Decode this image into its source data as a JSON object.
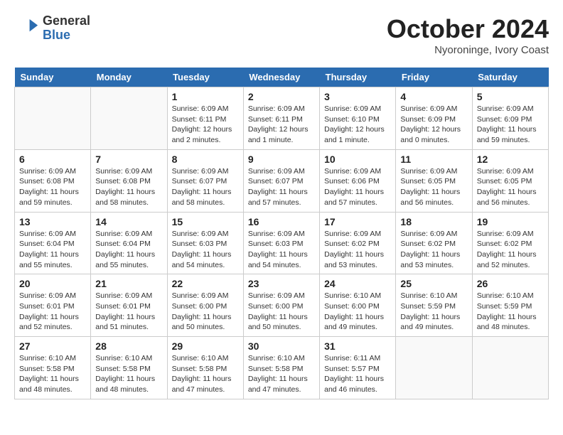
{
  "header": {
    "logo_line1": "General",
    "logo_line2": "Blue",
    "month": "October 2024",
    "location": "Nyoroninge, Ivory Coast"
  },
  "weekdays": [
    "Sunday",
    "Monday",
    "Tuesday",
    "Wednesday",
    "Thursday",
    "Friday",
    "Saturday"
  ],
  "weeks": [
    [
      {
        "day": "",
        "info": ""
      },
      {
        "day": "",
        "info": ""
      },
      {
        "day": "1",
        "info": "Sunrise: 6:09 AM\nSunset: 6:11 PM\nDaylight: 12 hours and 2 minutes."
      },
      {
        "day": "2",
        "info": "Sunrise: 6:09 AM\nSunset: 6:11 PM\nDaylight: 12 hours and 1 minute."
      },
      {
        "day": "3",
        "info": "Sunrise: 6:09 AM\nSunset: 6:10 PM\nDaylight: 12 hours and 1 minute."
      },
      {
        "day": "4",
        "info": "Sunrise: 6:09 AM\nSunset: 6:09 PM\nDaylight: 12 hours and 0 minutes."
      },
      {
        "day": "5",
        "info": "Sunrise: 6:09 AM\nSunset: 6:09 PM\nDaylight: 11 hours and 59 minutes."
      }
    ],
    [
      {
        "day": "6",
        "info": "Sunrise: 6:09 AM\nSunset: 6:08 PM\nDaylight: 11 hours and 59 minutes."
      },
      {
        "day": "7",
        "info": "Sunrise: 6:09 AM\nSunset: 6:08 PM\nDaylight: 11 hours and 58 minutes."
      },
      {
        "day": "8",
        "info": "Sunrise: 6:09 AM\nSunset: 6:07 PM\nDaylight: 11 hours and 58 minutes."
      },
      {
        "day": "9",
        "info": "Sunrise: 6:09 AM\nSunset: 6:07 PM\nDaylight: 11 hours and 57 minutes."
      },
      {
        "day": "10",
        "info": "Sunrise: 6:09 AM\nSunset: 6:06 PM\nDaylight: 11 hours and 57 minutes."
      },
      {
        "day": "11",
        "info": "Sunrise: 6:09 AM\nSunset: 6:05 PM\nDaylight: 11 hours and 56 minutes."
      },
      {
        "day": "12",
        "info": "Sunrise: 6:09 AM\nSunset: 6:05 PM\nDaylight: 11 hours and 56 minutes."
      }
    ],
    [
      {
        "day": "13",
        "info": "Sunrise: 6:09 AM\nSunset: 6:04 PM\nDaylight: 11 hours and 55 minutes."
      },
      {
        "day": "14",
        "info": "Sunrise: 6:09 AM\nSunset: 6:04 PM\nDaylight: 11 hours and 55 minutes."
      },
      {
        "day": "15",
        "info": "Sunrise: 6:09 AM\nSunset: 6:03 PM\nDaylight: 11 hours and 54 minutes."
      },
      {
        "day": "16",
        "info": "Sunrise: 6:09 AM\nSunset: 6:03 PM\nDaylight: 11 hours and 54 minutes."
      },
      {
        "day": "17",
        "info": "Sunrise: 6:09 AM\nSunset: 6:02 PM\nDaylight: 11 hours and 53 minutes."
      },
      {
        "day": "18",
        "info": "Sunrise: 6:09 AM\nSunset: 6:02 PM\nDaylight: 11 hours and 53 minutes."
      },
      {
        "day": "19",
        "info": "Sunrise: 6:09 AM\nSunset: 6:02 PM\nDaylight: 11 hours and 52 minutes."
      }
    ],
    [
      {
        "day": "20",
        "info": "Sunrise: 6:09 AM\nSunset: 6:01 PM\nDaylight: 11 hours and 52 minutes."
      },
      {
        "day": "21",
        "info": "Sunrise: 6:09 AM\nSunset: 6:01 PM\nDaylight: 11 hours and 51 minutes."
      },
      {
        "day": "22",
        "info": "Sunrise: 6:09 AM\nSunset: 6:00 PM\nDaylight: 11 hours and 50 minutes."
      },
      {
        "day": "23",
        "info": "Sunrise: 6:09 AM\nSunset: 6:00 PM\nDaylight: 11 hours and 50 minutes."
      },
      {
        "day": "24",
        "info": "Sunrise: 6:10 AM\nSunset: 6:00 PM\nDaylight: 11 hours and 49 minutes."
      },
      {
        "day": "25",
        "info": "Sunrise: 6:10 AM\nSunset: 5:59 PM\nDaylight: 11 hours and 49 minutes."
      },
      {
        "day": "26",
        "info": "Sunrise: 6:10 AM\nSunset: 5:59 PM\nDaylight: 11 hours and 48 minutes."
      }
    ],
    [
      {
        "day": "27",
        "info": "Sunrise: 6:10 AM\nSunset: 5:58 PM\nDaylight: 11 hours and 48 minutes."
      },
      {
        "day": "28",
        "info": "Sunrise: 6:10 AM\nSunset: 5:58 PM\nDaylight: 11 hours and 48 minutes."
      },
      {
        "day": "29",
        "info": "Sunrise: 6:10 AM\nSunset: 5:58 PM\nDaylight: 11 hours and 47 minutes."
      },
      {
        "day": "30",
        "info": "Sunrise: 6:10 AM\nSunset: 5:58 PM\nDaylight: 11 hours and 47 minutes."
      },
      {
        "day": "31",
        "info": "Sunrise: 6:11 AM\nSunset: 5:57 PM\nDaylight: 11 hours and 46 minutes."
      },
      {
        "day": "",
        "info": ""
      },
      {
        "day": "",
        "info": ""
      }
    ]
  ]
}
